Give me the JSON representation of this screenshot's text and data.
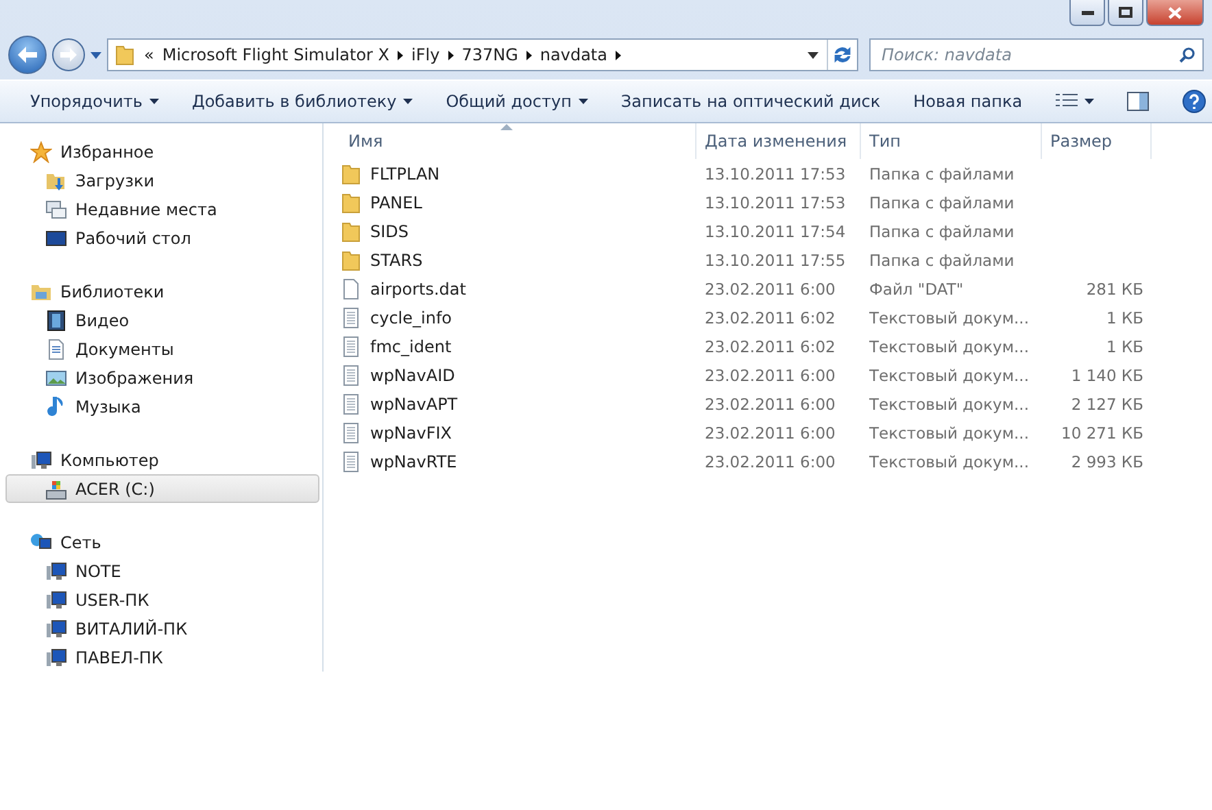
{
  "address": {
    "overflow": "«",
    "crumbs": [
      "Microsoft Flight Simulator X",
      "iFly",
      "737NG",
      "navdata"
    ]
  },
  "search": {
    "placeholder": "Поиск: navdata"
  },
  "toolbar": [
    {
      "label": "Упорядочить",
      "dropdown": true
    },
    {
      "label": "Добавить в библиотеку",
      "dropdown": true
    },
    {
      "label": "Общий доступ",
      "dropdown": true
    },
    {
      "label": "Записать на оптический диск",
      "dropdown": false
    },
    {
      "label": "Новая папка",
      "dropdown": false
    }
  ],
  "sidebar": {
    "groups": [
      {
        "label": "Избранное",
        "kind": "star",
        "items": [
          {
            "label": "Загрузки",
            "kind": "downloads",
            "selected": false
          },
          {
            "label": "Недавние места",
            "kind": "recent",
            "selected": false
          },
          {
            "label": "Рабочий стол",
            "kind": "desktop",
            "selected": false
          }
        ]
      },
      {
        "label": "Библиотеки",
        "kind": "library",
        "items": [
          {
            "label": "Видео",
            "kind": "video",
            "selected": false
          },
          {
            "label": "Документы",
            "kind": "documents",
            "selected": false
          },
          {
            "label": "Изображения",
            "kind": "images",
            "selected": false
          },
          {
            "label": "Музыка",
            "kind": "music",
            "selected": false
          }
        ]
      },
      {
        "label": "Компьютер",
        "kind": "computer",
        "items": [
          {
            "label": "ACER (C:)",
            "kind": "drive",
            "selected": true
          }
        ]
      },
      {
        "label": "Сеть",
        "kind": "network",
        "items": [
          {
            "label": "NOTE",
            "kind": "computer",
            "selected": false
          },
          {
            "label": "USER-ПК",
            "kind": "computer",
            "selected": false
          },
          {
            "label": "ВИТАЛИЙ-ПК",
            "kind": "computer",
            "selected": false
          },
          {
            "label": "ПАВЕЛ-ПК",
            "kind": "computer",
            "selected": false
          }
        ]
      }
    ]
  },
  "table": {
    "columns": [
      {
        "label": "Имя",
        "sorted": true
      },
      {
        "label": "Дата изменения",
        "sorted": false
      },
      {
        "label": "Тип",
        "sorted": false
      },
      {
        "label": "Размер",
        "sorted": false
      }
    ],
    "rows": [
      {
        "kind": "folder",
        "name": "FLTPLAN",
        "date": "13.10.2011 17:53",
        "type": "Папка с файлами",
        "size": ""
      },
      {
        "kind": "folder",
        "name": "PANEL",
        "date": "13.10.2011 17:53",
        "type": "Папка с файлами",
        "size": ""
      },
      {
        "kind": "folder",
        "name": "SIDS",
        "date": "13.10.2011 17:54",
        "type": "Папка с файлами",
        "size": ""
      },
      {
        "kind": "folder",
        "name": "STARS",
        "date": "13.10.2011 17:55",
        "type": "Папка с файлами",
        "size": ""
      },
      {
        "kind": "file",
        "name": "airports.dat",
        "date": "23.02.2011 6:00",
        "type": "Файл \"DAT\"",
        "size": "281 КБ"
      },
      {
        "kind": "text",
        "name": "cycle_info",
        "date": "23.02.2011 6:02",
        "type": "Текстовый докум...",
        "size": "1 КБ"
      },
      {
        "kind": "text",
        "name": "fmc_ident",
        "date": "23.02.2011 6:02",
        "type": "Текстовый докум...",
        "size": "1 КБ"
      },
      {
        "kind": "text",
        "name": "wpNavAID",
        "date": "23.02.2011 6:00",
        "type": "Текстовый докум...",
        "size": "1 140 КБ"
      },
      {
        "kind": "text",
        "name": "wpNavAPT",
        "date": "23.02.2011 6:00",
        "type": "Текстовый докум...",
        "size": "2 127 КБ"
      },
      {
        "kind": "text",
        "name": "wpNavFIX",
        "date": "23.02.2011 6:00",
        "type": "Текстовый докум...",
        "size": "10 271 КБ"
      },
      {
        "kind": "text",
        "name": "wpNavRTE",
        "date": "23.02.2011 6:00",
        "type": "Текстовый докум...",
        "size": "2 993 КБ"
      }
    ]
  }
}
